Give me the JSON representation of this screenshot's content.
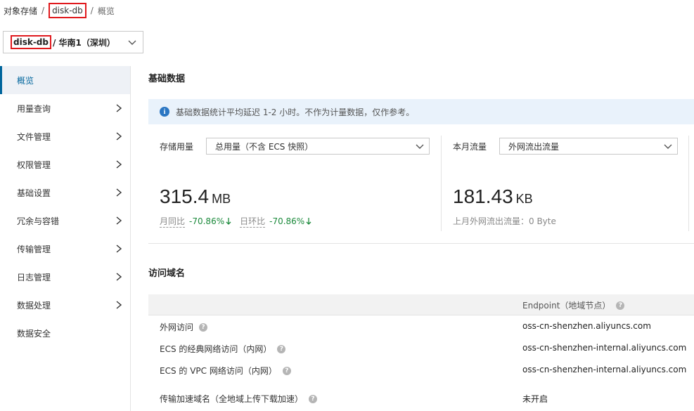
{
  "breadcrumb": {
    "root": "对象存储",
    "bucket": "disk-db",
    "current": "概览"
  },
  "bucket_selector": {
    "bucket": "disk-db",
    "region": "/ 华南1（深圳）"
  },
  "sidebar": {
    "items": [
      {
        "label": "概览",
        "active": true,
        "has_arrow": false
      },
      {
        "label": "用量查询",
        "has_arrow": true
      },
      {
        "label": "文件管理",
        "has_arrow": true
      },
      {
        "label": "权限管理",
        "has_arrow": true
      },
      {
        "label": "基础设置",
        "has_arrow": true
      },
      {
        "label": "冗余与容错",
        "has_arrow": true
      },
      {
        "label": "传输管理",
        "has_arrow": true
      },
      {
        "label": "日志管理",
        "has_arrow": true
      },
      {
        "label": "数据处理",
        "has_arrow": true
      },
      {
        "label": "数据安全",
        "has_arrow": false
      }
    ]
  },
  "basic": {
    "title": "基础数据",
    "notice": "基础数据统计平均延迟 1-2 小时。不作为计量数据，仅作参考。",
    "storage": {
      "label": "存储用量",
      "select": "总用量（不含 ECS 快照）",
      "value": "315.4",
      "unit": "MB",
      "mom_label": "月同比",
      "mom_value": "-70.86%",
      "dod_label": "日环比",
      "dod_value": "-70.86%"
    },
    "traffic": {
      "label": "本月流量",
      "select": "外网流出流量",
      "value": "181.43",
      "unit": "KB",
      "sub": "上月外网流出流量：0 Byte"
    }
  },
  "domains": {
    "title": "访问域名",
    "col_endpoint": "Endpoint（地域节点）",
    "rows": [
      {
        "name": "外网访问",
        "value": "oss-cn-shenzhen.aliyuncs.com"
      },
      {
        "name": "ECS 的经典网络访问（内网）",
        "value": "oss-cn-shenzhen-internal.aliyuncs.com"
      },
      {
        "name": "ECS 的 VPC 网络访问（内网）",
        "value": "oss-cn-shenzhen-internal.aliyuncs.com"
      },
      {
        "name": "传输加速域名（全地域上传下载加速）",
        "value": "未开启"
      }
    ]
  },
  "colors": {
    "accent": "#00659c",
    "highlight": "#e0191d",
    "down": "#1c8a3c",
    "notice_bg": "#e9f2fb"
  }
}
